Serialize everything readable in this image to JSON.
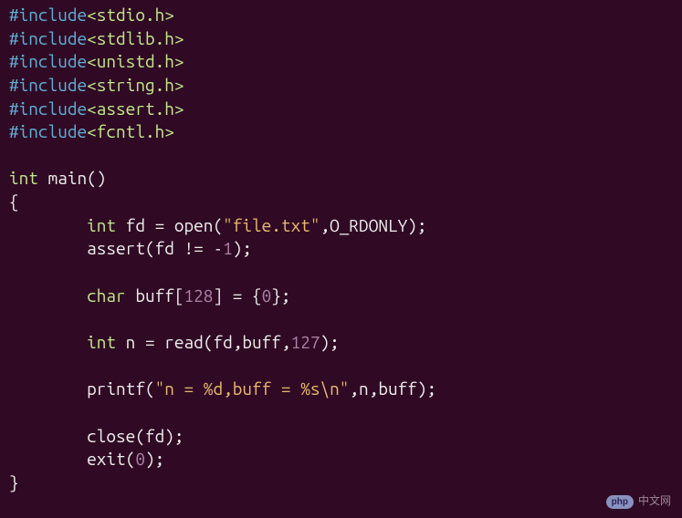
{
  "lines": {
    "inc1_dir": "#include",
    "inc1_h": "<stdio.h>",
    "inc2_dir": "#include",
    "inc2_h": "<stdlib.h>",
    "inc3_dir": "#include",
    "inc3_h": "<unistd.h>",
    "inc4_dir": "#include",
    "inc4_h": "<string.h>",
    "inc5_dir": "#include",
    "inc5_h": "<assert.h>",
    "inc6_dir": "#include",
    "inc6_h": "<fcntl.h>",
    "main_ret": "int",
    "main_name": " main()",
    "brace_open": "{",
    "l1_indent": "        ",
    "l1_type": "int",
    "l1_decl": " fd = open(",
    "l1_str": "\"file.txt\"",
    "l1_mid": ",O_RDONLY);",
    "l2_indent": "        ",
    "l2_call": "assert(fd != -",
    "l2_num": "1",
    "l2_end": ");",
    "l3_indent": "        ",
    "l3_type": "char",
    "l3_decl": " buff[",
    "l3_num": "128",
    "l3_mid": "] = {",
    "l3_num2": "0",
    "l3_end": "};",
    "l4_indent": "        ",
    "l4_type": "int",
    "l4_decl": " n = read(fd,buff,",
    "l4_num": "127",
    "l4_end": ");",
    "l5_indent": "        ",
    "l5_call": "printf(",
    "l5_str": "\"n = %d,buff = %s\\n\"",
    "l5_end": ",n,buff);",
    "l6_indent": "        ",
    "l6_call": "close(fd);",
    "l7_indent": "        ",
    "l7_call": "exit(",
    "l7_num": "0",
    "l7_end": ");",
    "brace_close": "}"
  },
  "watermark": {
    "logo": "php",
    "text": "中文网"
  }
}
